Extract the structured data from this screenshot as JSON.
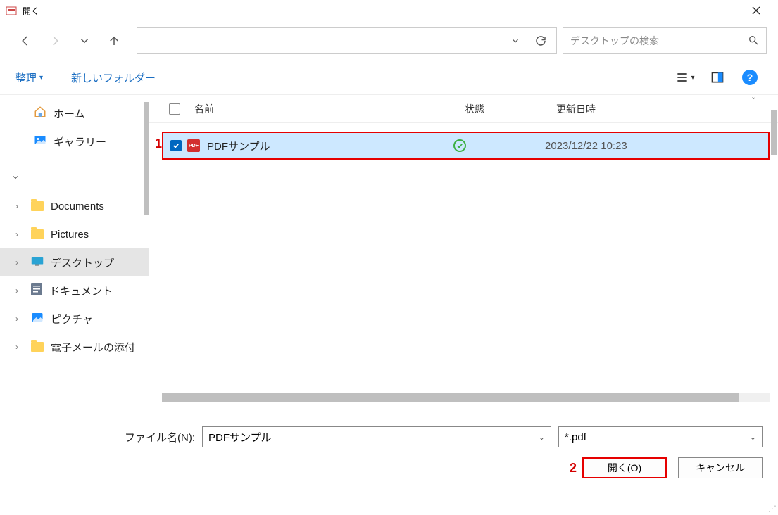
{
  "title": "開く",
  "search_placeholder": "デスクトップの検索",
  "toolbar": {
    "organize": "整理",
    "new_folder": "新しいフォルダー"
  },
  "sidebar": {
    "home": "ホーム",
    "gallery": "ギャラリー",
    "items": [
      {
        "label": "Documents",
        "icon": "folder"
      },
      {
        "label": "Pictures",
        "icon": "folder"
      },
      {
        "label": "デスクトップ",
        "icon": "desktop",
        "selected": true
      },
      {
        "label": "ドキュメント",
        "icon": "doc"
      },
      {
        "label": "ピクチャ",
        "icon": "pic"
      },
      {
        "label": "電子メールの添付",
        "icon": "folder"
      }
    ]
  },
  "columns": {
    "name": "名前",
    "status": "状態",
    "date": "更新日時"
  },
  "file": {
    "name": "PDFサンプル",
    "date": "2023/12/22 10:23",
    "pdf_badge": "PDF"
  },
  "annotations": {
    "one": "1",
    "two": "2"
  },
  "filename_label": "ファイル名(N):",
  "filename_value": "PDFサンプル",
  "filter_value": "*.pdf",
  "buttons": {
    "open": "開く(O)",
    "cancel": "キャンセル"
  }
}
